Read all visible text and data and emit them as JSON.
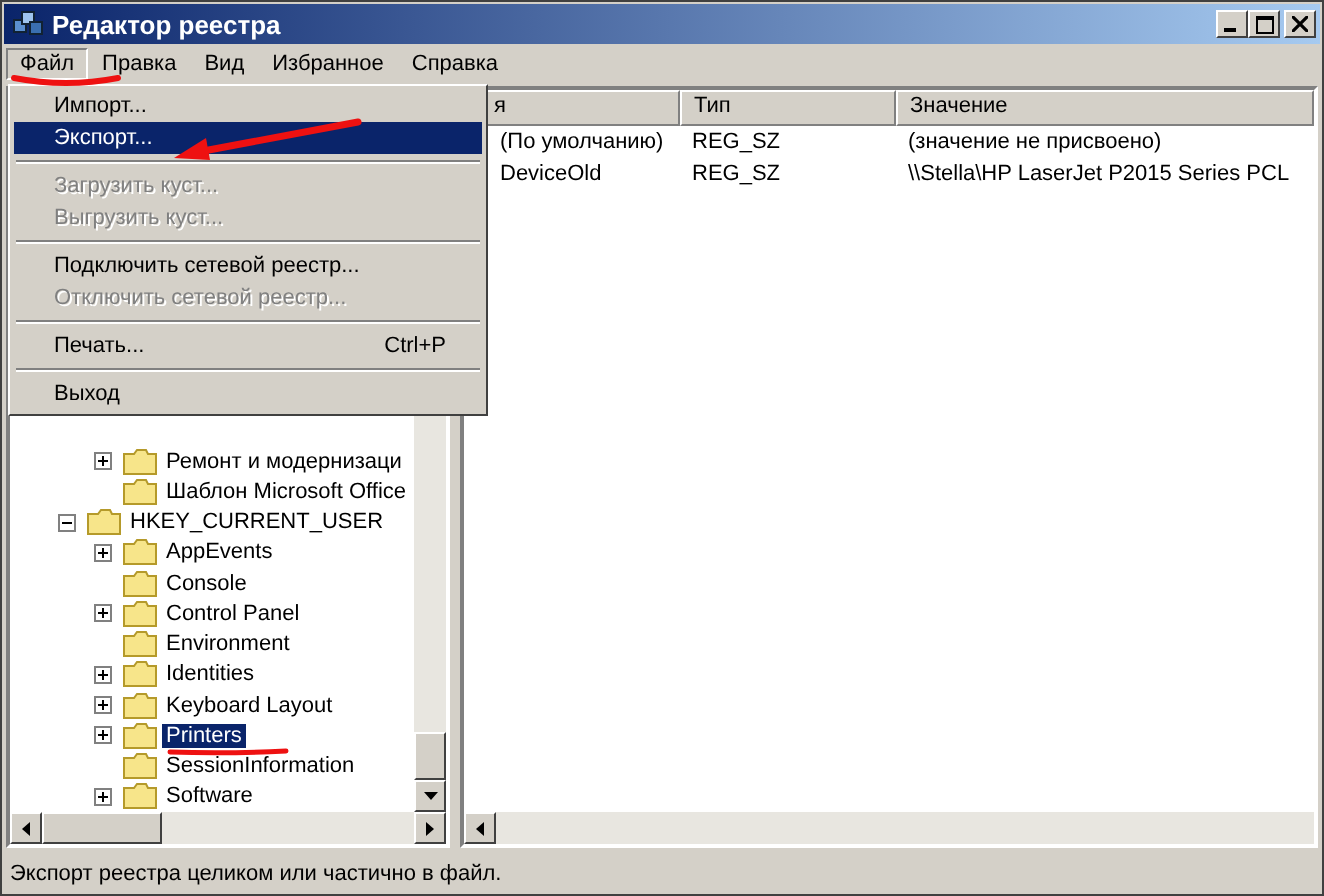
{
  "window": {
    "title": "Редактор реестра"
  },
  "menu_bar": [
    {
      "label": "Файл",
      "selected": true
    },
    {
      "label": "Правка",
      "selected": false
    },
    {
      "label": "Вид",
      "selected": false
    },
    {
      "label": "Избранное",
      "selected": false
    },
    {
      "label": "Справка",
      "selected": false
    }
  ],
  "file_menu": [
    {
      "kind": "item",
      "label": "Импорт...",
      "disabled": false,
      "selected": false
    },
    {
      "kind": "item",
      "label": "Экспорт...",
      "disabled": false,
      "selected": true
    },
    {
      "kind": "separator"
    },
    {
      "kind": "item",
      "label": "Загрузить куст...",
      "disabled": true,
      "selected": false
    },
    {
      "kind": "item",
      "label": "Выгрузить куст...",
      "disabled": true,
      "selected": false
    },
    {
      "kind": "separator"
    },
    {
      "kind": "item",
      "label": "Подключить сетевой реестр...",
      "disabled": false,
      "selected": false
    },
    {
      "kind": "item",
      "label": "Отключить сетевой реестр...",
      "disabled": true,
      "selected": false
    },
    {
      "kind": "separator"
    },
    {
      "kind": "item",
      "label": "Печать...",
      "shortcut": "Ctrl+P",
      "disabled": false,
      "selected": false
    },
    {
      "kind": "separator"
    },
    {
      "kind": "item",
      "label": "Выход",
      "disabled": false,
      "selected": false
    }
  ],
  "tree": [
    {
      "children": [
        {
          "label": "Ремонт и модернизаци",
          "expanded": false,
          "selected": false
        },
        {
          "label": "Шаблон Microsoft Office",
          "selected": false
        }
      ]
    },
    {
      "label": "HKEY_CURRENT_USER",
      "expanded": true,
      "selected": false,
      "children": [
        {
          "label": "AppEvents",
          "expanded": false,
          "selected": false
        },
        {
          "label": "Console",
          "selected": false
        },
        {
          "label": "Control Panel",
          "expanded": false,
          "selected": false
        },
        {
          "label": "Environment",
          "selected": false
        },
        {
          "label": "Identities",
          "expanded": false,
          "selected": false
        },
        {
          "label": "Keyboard Layout",
          "expanded": false,
          "selected": false
        },
        {
          "label": "Printers",
          "expanded": false,
          "selected": true
        },
        {
          "label": "SessionInformation",
          "selected": false
        },
        {
          "label": "Software",
          "expanded": false,
          "selected": false
        }
      ]
    }
  ],
  "table": {
    "columns": [
      "я",
      "Тип",
      "Значение"
    ],
    "rows": [
      [
        "(По умолчанию)",
        "REG_SZ",
        "(значение не присвоено)"
      ],
      [
        "DeviceOld",
        "REG_SZ",
        "\\\\Stella\\HP LaserJet P2015 Series PCL"
      ]
    ]
  },
  "status_bar": "Экспорт реестра целиком или частично в файл."
}
